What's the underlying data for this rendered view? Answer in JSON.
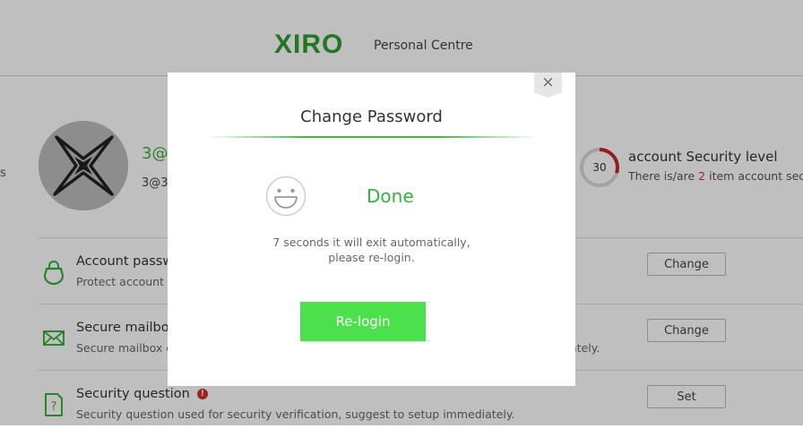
{
  "header": {
    "logo": "XIRO",
    "subtitle": "Personal Centre"
  },
  "left_edge_mark": "s",
  "profile": {
    "name": "3@",
    "account_id": "3@3"
  },
  "security": {
    "score": "30",
    "score_fraction": 0.3,
    "title": "account Security level",
    "desc_prefix": "There is/are ",
    "desc_count": "2",
    "desc_suffix": " item account secur",
    "accent_color": "#c62828"
  },
  "rows": [
    {
      "icon": "lock-icon",
      "title": "Account passw",
      "desc": "Protect account in",
      "button": "Change"
    },
    {
      "icon": "mail-icon",
      "title": "Secure mailbox",
      "desc": "Secure mailbox ca",
      "desc_tail": "ately.",
      "button": "Change"
    },
    {
      "icon": "question-doc-icon",
      "title": "Security question",
      "warning": "!",
      "desc": "Security question used for security verification, suggest to setup immediately.",
      "button": "Set"
    }
  ],
  "modal": {
    "title": "Change Password",
    "close": "×",
    "status": "Done",
    "message_line1": "7 seconds it will exit automatically,",
    "message_line2": "please re-login.",
    "button": "Re-login"
  },
  "colors": {
    "brand_green": "#2f9e2f",
    "button_green": "#4ce04c",
    "overlay": "rgba(0,0,0,0.25)"
  }
}
